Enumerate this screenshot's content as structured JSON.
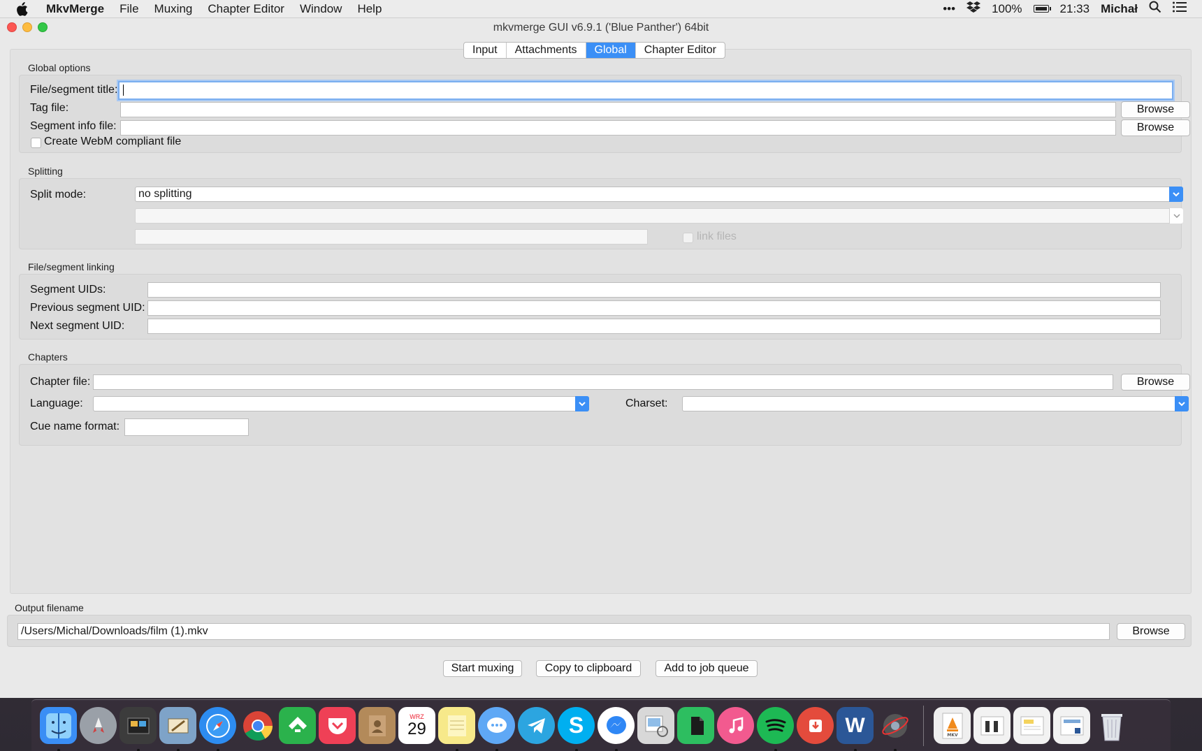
{
  "menubar": {
    "app": "MkvMerge",
    "items": [
      "File",
      "Muxing",
      "Chapter Editor",
      "Window",
      "Help"
    ],
    "status": {
      "dots": "•••",
      "battery": "100%",
      "clock": "21:33",
      "user": "Michał"
    }
  },
  "window": {
    "title": "mkvmerge GUI v6.9.1 ('Blue Panther') 64bit",
    "tabs": [
      "Input",
      "Attachments",
      "Global",
      "Chapter Editor"
    ],
    "active_tab": "Global"
  },
  "global_options": {
    "title": "Global options",
    "segment_title_label": "File/segment title:",
    "segment_title_value": "",
    "tag_file_label": "Tag file:",
    "tag_file_value": "",
    "segment_info_label": "Segment info file:",
    "segment_info_value": "",
    "browse": "Browse",
    "webm_label": "Create WebM compliant file"
  },
  "splitting": {
    "title": "Splitting",
    "split_mode_label": "Split mode:",
    "split_mode_value": "no splitting",
    "link_files_label": "link files"
  },
  "linking": {
    "title": "File/segment linking",
    "segment_uids_label": "Segment UIDs:",
    "prev_uid_label": "Previous segment UID:",
    "next_uid_label": "Next segment UID:"
  },
  "chapters": {
    "title": "Chapters",
    "chapter_file_label": "Chapter file:",
    "language_label": "Language:",
    "charset_label": "Charset:",
    "cue_name_label": "Cue name format:",
    "browse": "Browse"
  },
  "output": {
    "title": "Output filename",
    "value": "/Users/Michal/Downloads/film (1).mkv",
    "browse": "Browse"
  },
  "actions": {
    "start": "Start muxing",
    "copy": "Copy to clipboard",
    "queue": "Add to job queue"
  },
  "dock": {
    "calendar_month": "WRZ",
    "calendar_day": "29",
    "apps": [
      "finder",
      "launchpad",
      "photo-booth",
      "mail",
      "safari",
      "chrome",
      "feedly",
      "pocket",
      "contacts",
      "calendar",
      "notes",
      "messages",
      "telegram",
      "skype",
      "messenger",
      "preview",
      "evernote",
      "itunes",
      "spotify",
      "downloader",
      "word",
      "app",
      "mkv-document",
      "document-1",
      "document-2",
      "document-3",
      "trash"
    ],
    "colors": {
      "finder": "#3a8ef5",
      "launchpad": "#9aa0a8",
      "photo-booth": "#3c3c3c",
      "mail": "#7ea3c8",
      "safari": "#2d8cf0",
      "chrome": "#e9e9e9",
      "feedly": "#2bb24c",
      "pocket": "#ef4056",
      "contacts": "#b38a5a",
      "calendar": "#ffffff",
      "notes": "#f7e98a",
      "messages": "#5fa8f5",
      "telegram": "#2ca5e0",
      "skype": "#00aff0",
      "messenger": "#2f87f5",
      "preview": "#d8d8d8",
      "evernote": "#2dbe60",
      "itunes": "#f25a8f",
      "spotify": "#1db954",
      "downloader": "#e44b3c",
      "word": "#2b5797",
      "app": "#555555",
      "mkv-document": "#efefef",
      "document": "#f2f2f2",
      "trash": "#c8ccd2"
    }
  },
  "accent": "#3b8ff6"
}
